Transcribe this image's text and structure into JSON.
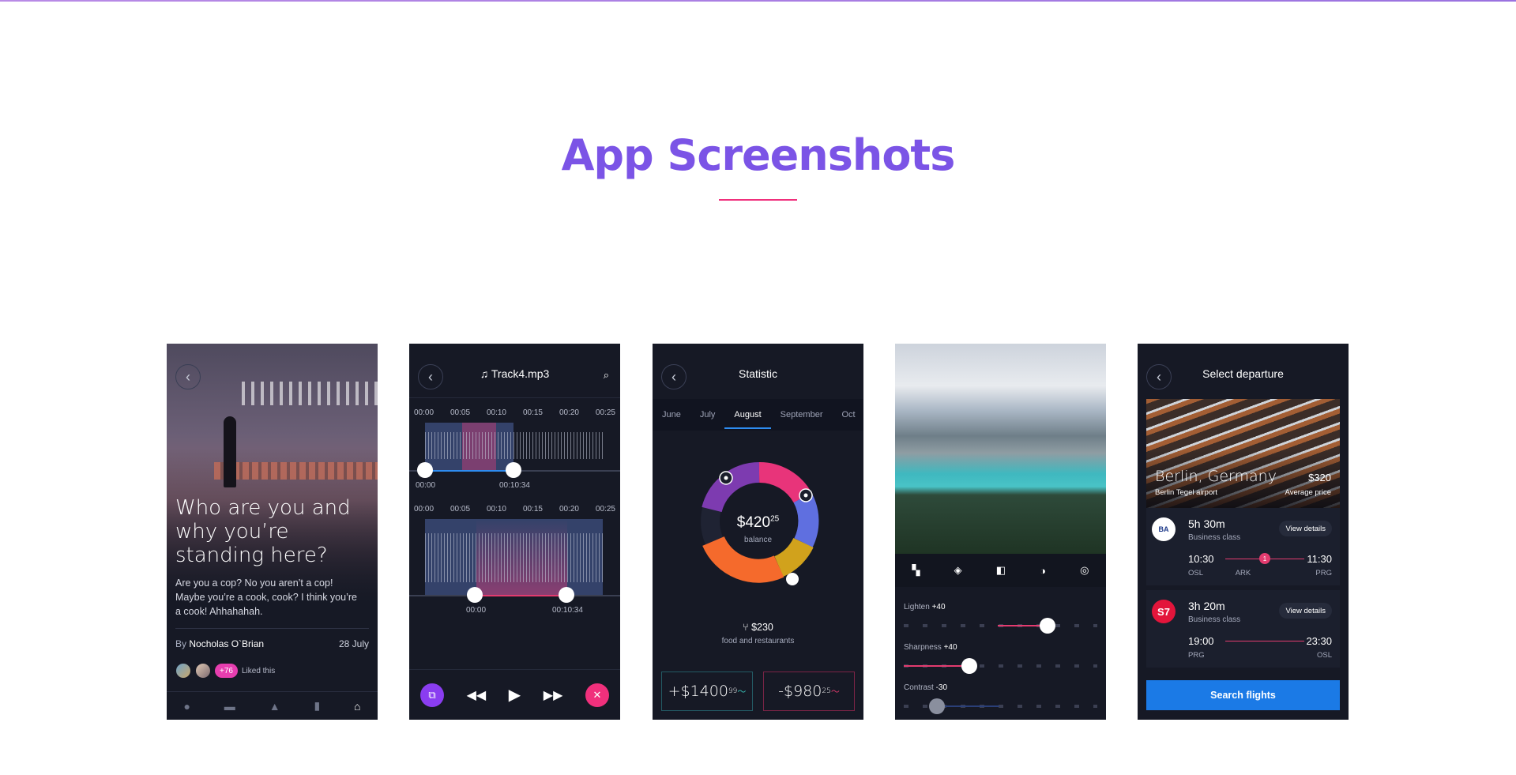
{
  "section": {
    "title": "App Screenshots"
  },
  "phone1": {
    "headline": "Who are you and why you’re standing here?",
    "body": "Are you a cop? No you aren’t a cop! Maybe you’re a cook, cook? I think you’re a cook! Ahhahahah.",
    "by_prefix": "By",
    "author": "Nocholas O`Brian",
    "date": "28 July",
    "likes_count": "+76",
    "likes_label": "Liked this",
    "tab_icons": [
      "user-icon",
      "chat-icon",
      "bell-icon",
      "bookmark-icon",
      "home-icon"
    ]
  },
  "phone2": {
    "title": "Track4.mp3",
    "timeline": [
      "00:00",
      "00:05",
      "00:10",
      "00:15",
      "00:20",
      "00:25"
    ],
    "top_range": {
      "start": "00:00",
      "end": "00:10:34"
    },
    "bottom_range": {
      "start": "00:00",
      "end": "00:10:34"
    }
  },
  "phone3": {
    "title": "Statistic",
    "months": [
      "June",
      "July",
      "August",
      "September",
      "Oct"
    ],
    "active_month": "August",
    "balance": "$420",
    "balance_cents": "25",
    "balance_label": "balance",
    "category_value": "$230",
    "category_label": "food and restaurants",
    "income": "+$1400",
    "income_cents": "99",
    "expense": "-$980",
    "expense_cents": "25"
  },
  "phone4": {
    "tools": [
      "grid-icon",
      "fill-icon",
      "contrast-icon",
      "exposure-icon",
      "timer-icon"
    ],
    "sliders": [
      {
        "label": "Lighten",
        "value": "+40"
      },
      {
        "label": "Sharpness",
        "value": "+40"
      },
      {
        "label": "Contrast",
        "value": "-30"
      }
    ]
  },
  "phone5": {
    "title": "Select departure",
    "city": "Berlin, Germany",
    "price": "$320",
    "airport": "Berlin Tegel airport",
    "avg_label": "Average price",
    "flights": [
      {
        "logo": "BA",
        "duration": "5h 30m",
        "class": "Business class",
        "view": "View details",
        "dep_time": "10:30",
        "arr_time": "11:30",
        "dep": "OSL",
        "stop": "ARK",
        "stops": "1",
        "arr": "PRG"
      },
      {
        "logo": "S7",
        "duration": "3h 20m",
        "class": "Business class",
        "view": "View details",
        "dep_time": "19:00",
        "arr_time": "23:30",
        "dep": "PRG",
        "arr": "OSL"
      }
    ],
    "search": "Search flights"
  },
  "colors": {
    "accent": "#7b54e6",
    "pink": "#f0307c",
    "blue": "#1b7ae6",
    "phone_bg": "#161925"
  }
}
